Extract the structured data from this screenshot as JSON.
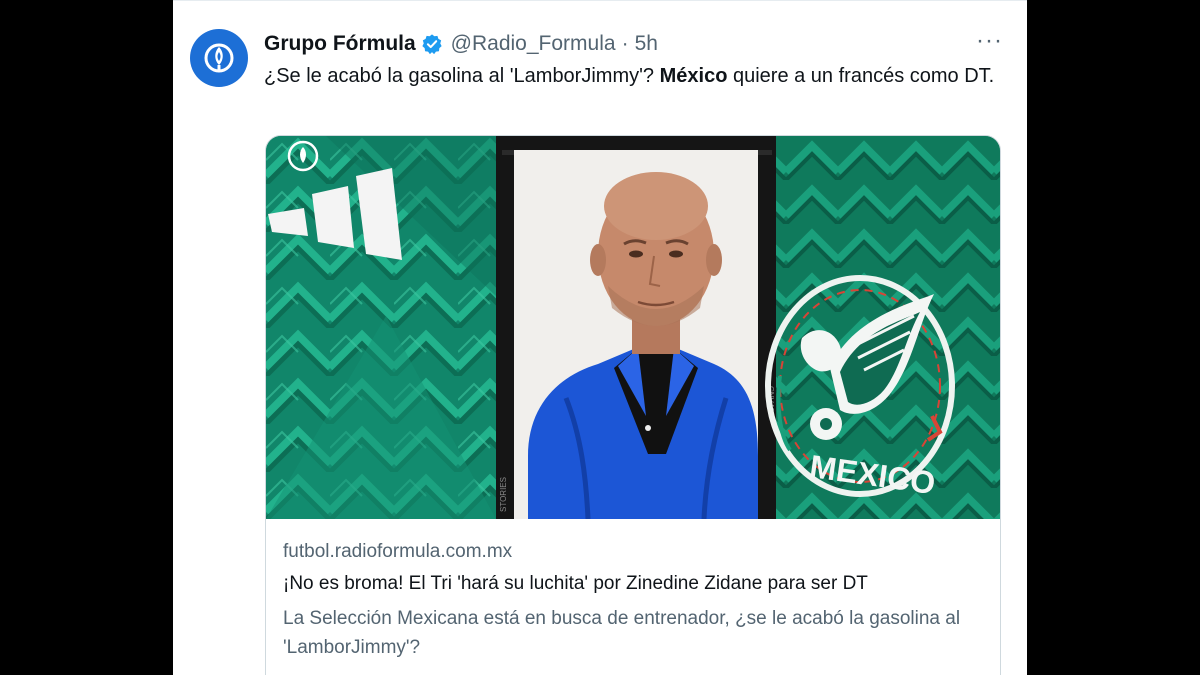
{
  "tweet": {
    "author_name": "Grupo Fórmula",
    "handle": "@Radio_Formula",
    "separator": "·",
    "time": "5h",
    "more_label": "···",
    "text_before": "¿Se le acabó la gasolina al 'LamborJimmy'? ",
    "text_bold": "México",
    "text_after": " quiere a un francés como DT.",
    "verified_color": "#1d9bf0",
    "avatar_color": "#1d6fd6",
    "icons": {
      "avatar": "grupo-formula-logo-icon",
      "verified": "verified-badge-icon",
      "more": "more-options-icon"
    }
  },
  "card": {
    "domain": "futbol.radioformula.com.mx",
    "title": "¡No es broma! El Tri 'hará su luchita' por Zinedine Zidane para ser DT",
    "description": "La Selección Mexicana está en busca de entrenador, ¿se le acabó la gasolina al 'LamborJimmy'?",
    "image": {
      "frame_side_text_left": "STORIES",
      "frame_side_text_right": "CNV40",
      "crest_text": "MEXICO",
      "background_color": "#138a62"
    }
  }
}
